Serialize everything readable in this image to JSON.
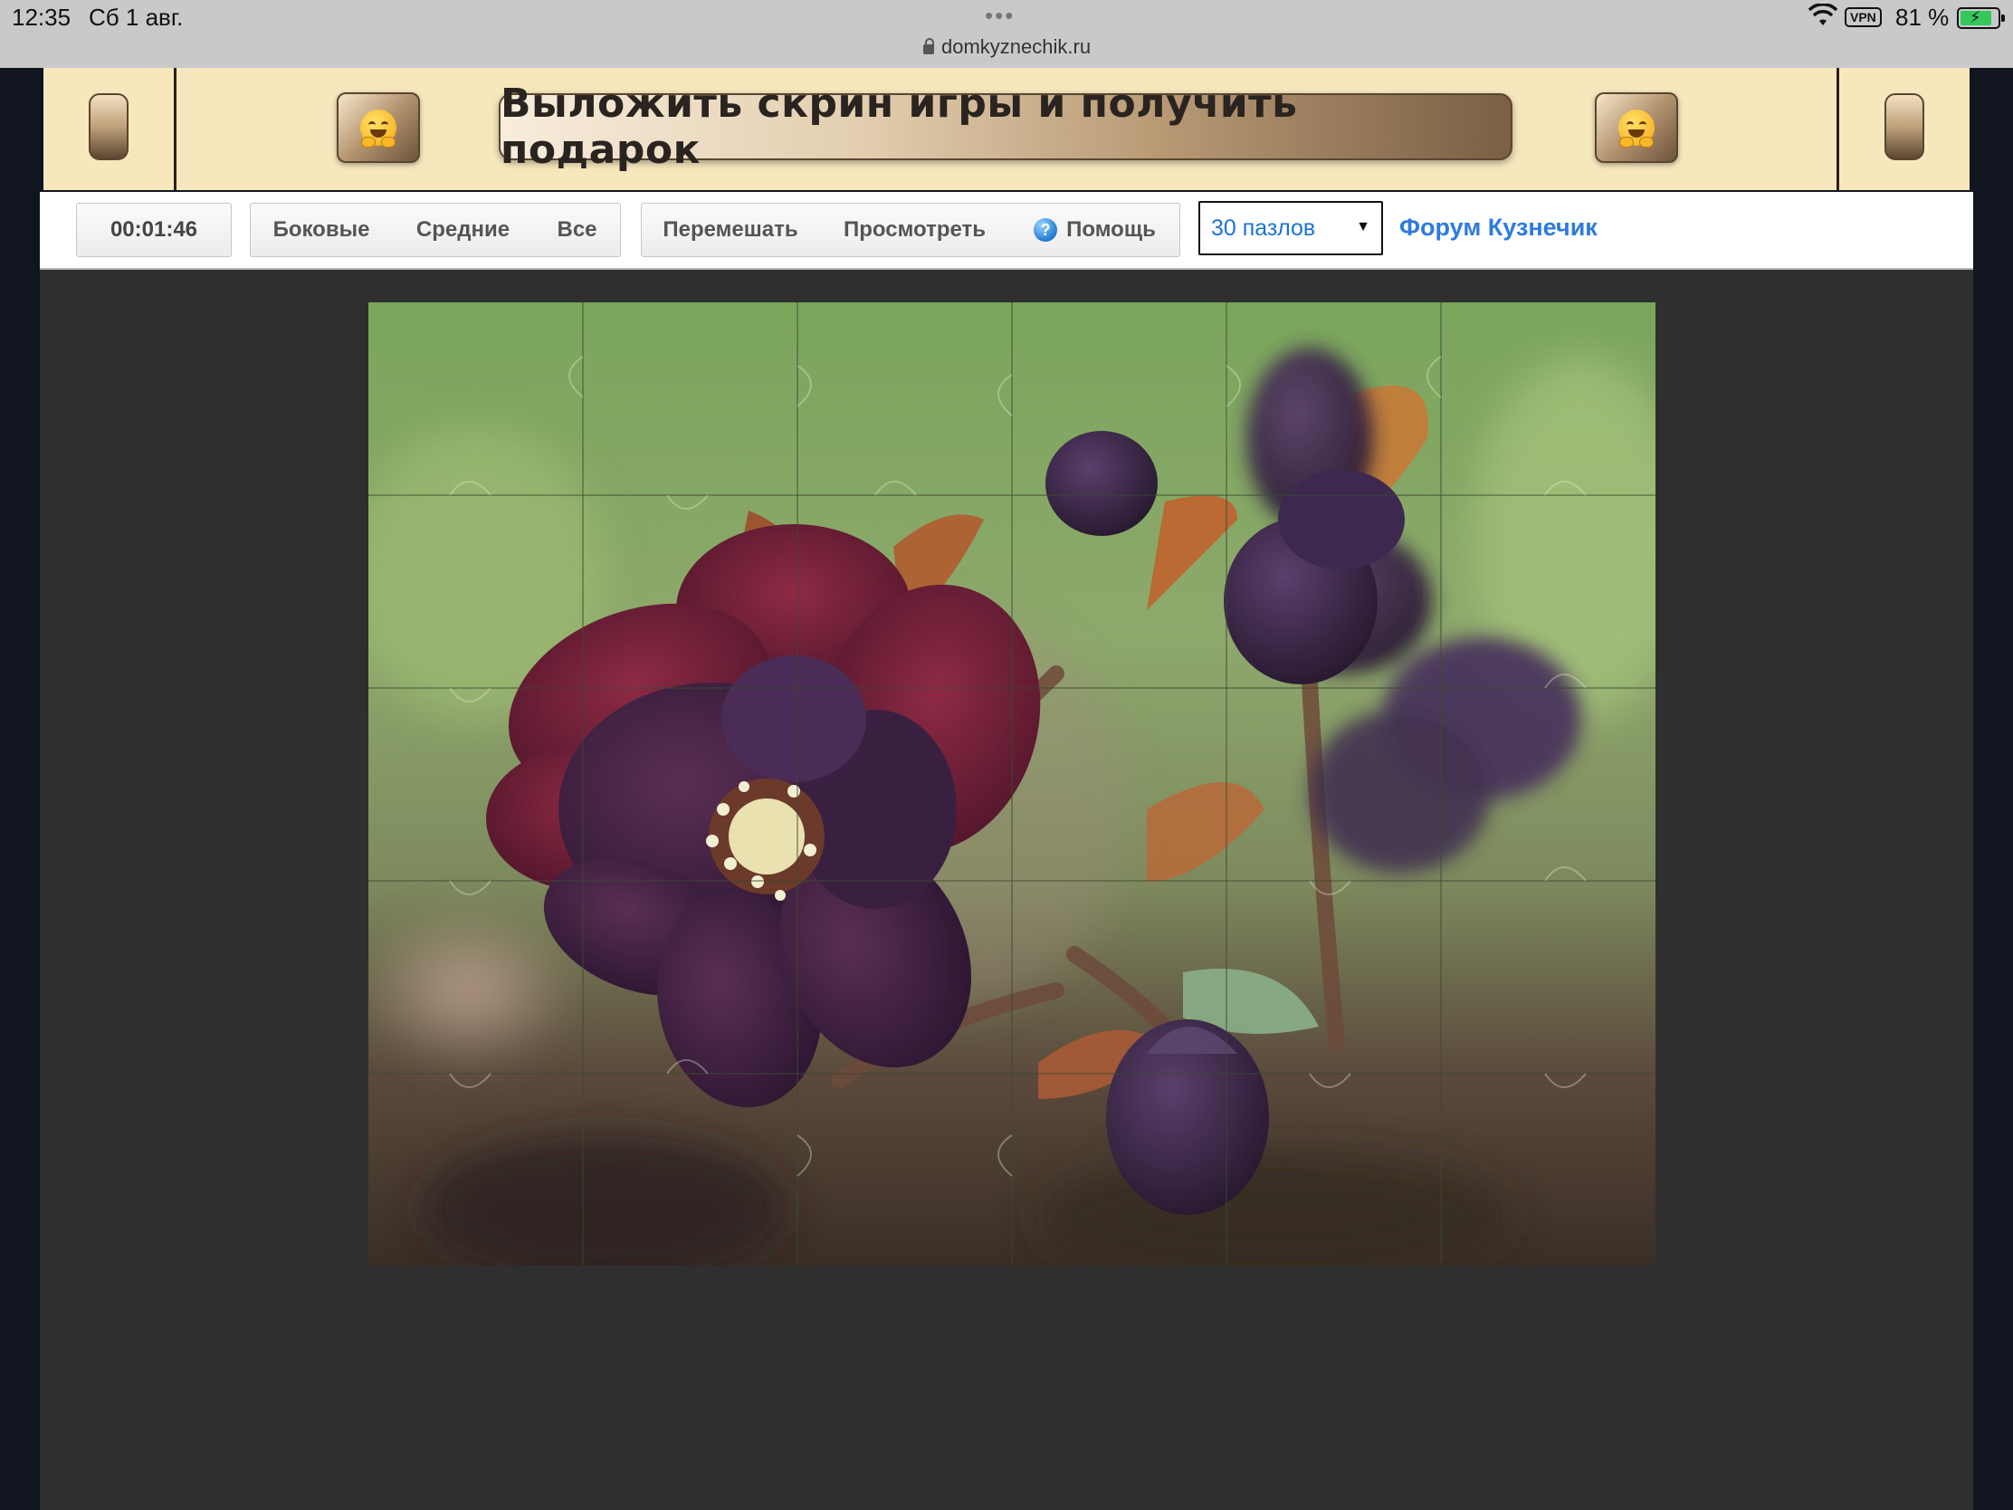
{
  "status_bar": {
    "time": "12:35",
    "date": "Сб 1 авг.",
    "dots": "•••",
    "url": "domkyznechik.ru",
    "vpn": "VPN",
    "battery": "81 %"
  },
  "banner": {
    "promo_text": "Выложить скрин игры и получить подарок",
    "emoji_icon": "hugging-face-icon"
  },
  "toolbar": {
    "timer": "00:01:46",
    "filter_buttons": [
      "Боковые",
      "Средние",
      "Все"
    ],
    "action_buttons": [
      "Перемешать",
      "Просмотреть",
      "Помощь"
    ],
    "help_icon_glyph": "?",
    "pieces_select": "30 пазлов",
    "forum_link": "Форум Кузнечик"
  },
  "puzzle": {
    "pieces_total": 30,
    "columns": 6,
    "rows": 5,
    "image_subject": "dark purple hellebore flower"
  },
  "colors": {
    "link": "#2e7be0",
    "banner_bg": "#f7e7bd",
    "game_bg": "#2f2f2f"
  }
}
